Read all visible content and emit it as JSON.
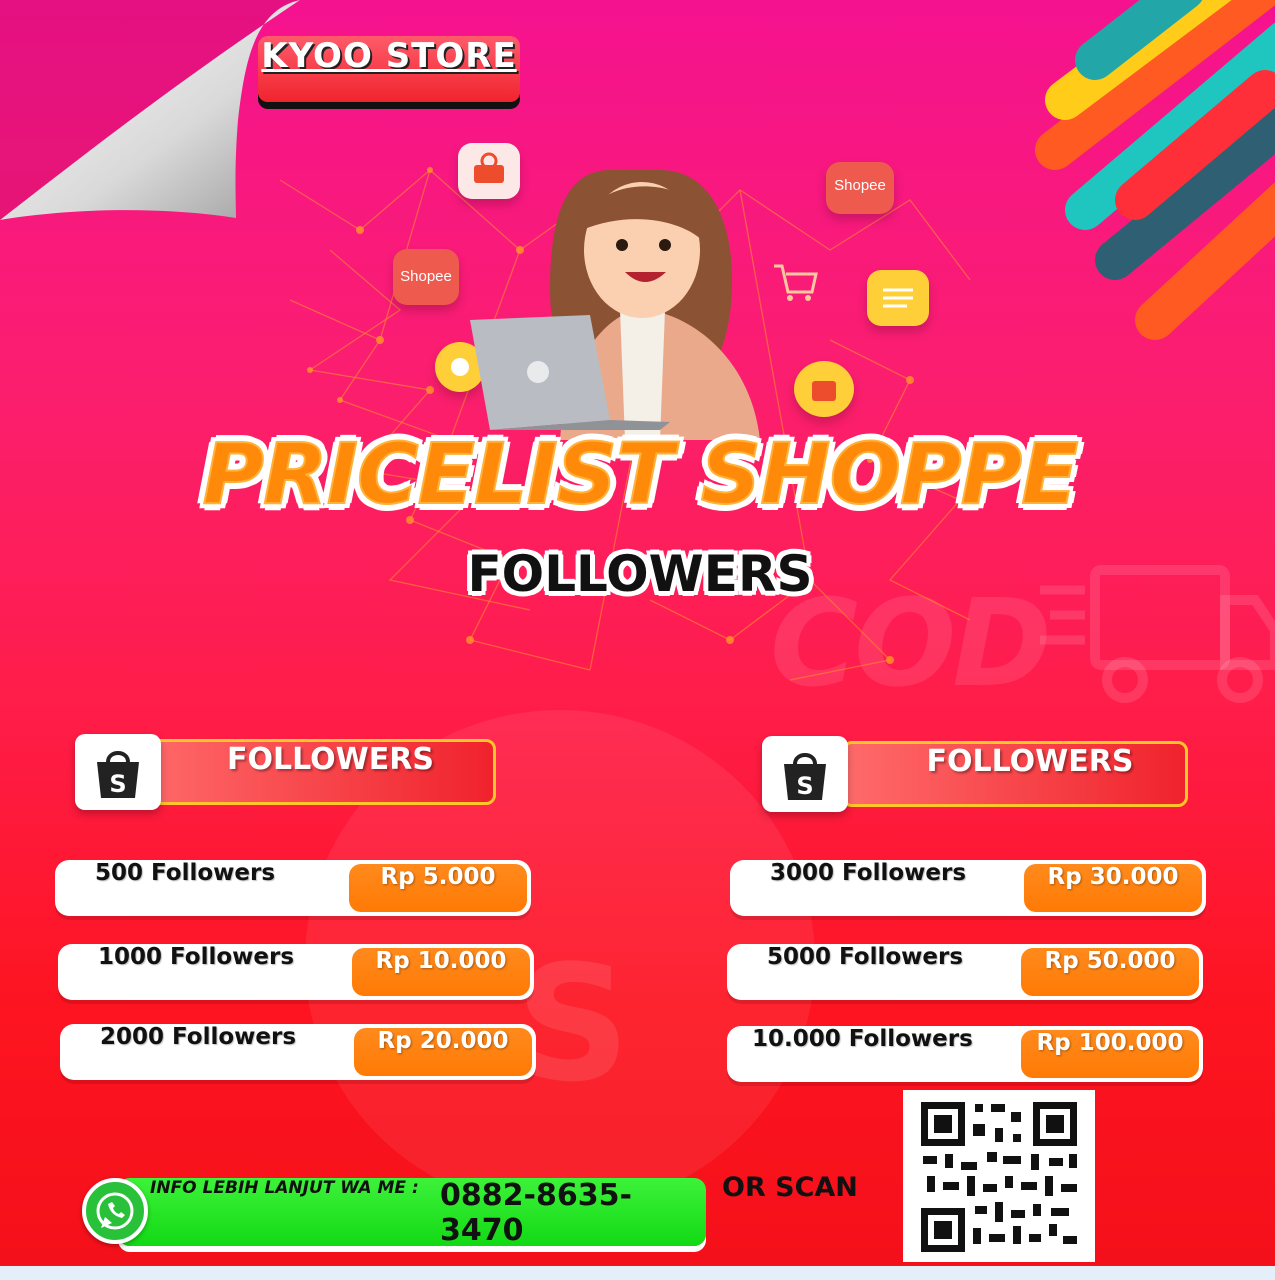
{
  "store": {
    "name": "KYOO STORE"
  },
  "floating_labels": {
    "shopee_left": "Shopee",
    "shopee_right": "Shopee"
  },
  "title": {
    "main": "PRICELIST SHOPPE",
    "sub": "FOLLOWERS"
  },
  "watermark": {
    "cod": "COD"
  },
  "columns": [
    {
      "header": "FOLLOWERS",
      "items": [
        {
          "qty": "500 Followers",
          "price": "Rp 5.000"
        },
        {
          "qty": "1000 Followers",
          "price": "Rp 10.000"
        },
        {
          "qty": "2000 Followers",
          "price": "Rp 20.000"
        }
      ]
    },
    {
      "header": "FOLLOWERS",
      "items": [
        {
          "qty": "3000 Followers",
          "price": "Rp 30.000"
        },
        {
          "qty": "5000 Followers",
          "price": "Rp 50.000"
        },
        {
          "qty": "10.000 Followers",
          "price": "Rp 100.000"
        }
      ]
    }
  ],
  "contact": {
    "label": "INFO LEBIH LANJUT WA ME :",
    "phone": "0882-8635-3470",
    "or_scan": "OR SCAN"
  },
  "icons": [
    "shopee-bag-icon",
    "whatsapp-icon",
    "qr-code-icon",
    "shopping-cart-icon",
    "chat-icon",
    "laptop-icon"
  ],
  "colors": {
    "brand_pink": "#f5128f",
    "brand_red": "#fd1420",
    "price_orange": "#ff7a05",
    "contact_green": "#12d914",
    "title_orange": "#ff8a0a"
  }
}
